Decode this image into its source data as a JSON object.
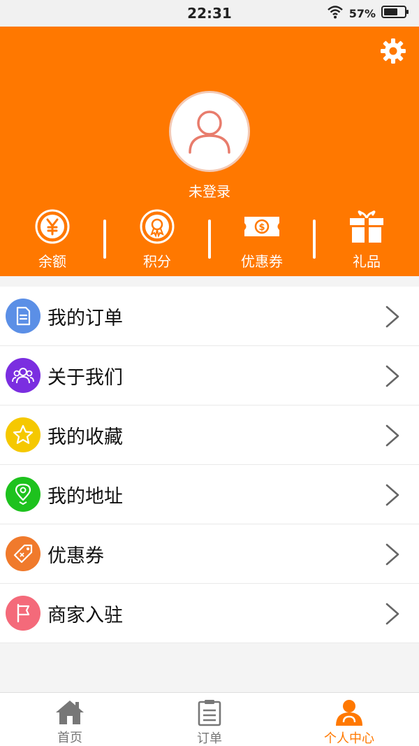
{
  "status_bar": {
    "time": "22:31",
    "battery": "57%"
  },
  "header": {
    "settings_icon": "gear-icon",
    "avatar_icon": "user-icon",
    "login_status": "未登录",
    "stats": [
      {
        "label": "余额",
        "icon": "yen-coin-icon"
      },
      {
        "label": "积分",
        "icon": "medal-icon"
      },
      {
        "label": "优惠券",
        "icon": "ticket-icon"
      },
      {
        "label": "礼品",
        "icon": "gift-icon"
      }
    ]
  },
  "menu": {
    "items": [
      {
        "label": "我的订单",
        "icon": "document-icon",
        "color": "#5b8fe6"
      },
      {
        "label": "关于我们",
        "icon": "group-icon",
        "color": "#7b2ee0"
      },
      {
        "label": "我的收藏",
        "icon": "star-icon",
        "color": "#f5c800"
      },
      {
        "label": "我的地址",
        "icon": "location-icon",
        "color": "#1ec21e"
      },
      {
        "label": "优惠券",
        "icon": "coupon-tag-icon",
        "color": "#f07a2c"
      },
      {
        "label": "商家入驻",
        "icon": "flag-icon",
        "color": "#f46a7a"
      }
    ]
  },
  "tabbar": {
    "tabs": [
      {
        "label": "首页",
        "icon": "home-icon",
        "active": false
      },
      {
        "label": "订单",
        "icon": "clipboard-icon",
        "active": false
      },
      {
        "label": "个人中心",
        "icon": "profile-icon",
        "active": true
      }
    ]
  },
  "colors": {
    "brand": "#ff7800",
    "header_text": "#ffffff",
    "inactive_tab": "#777777"
  }
}
